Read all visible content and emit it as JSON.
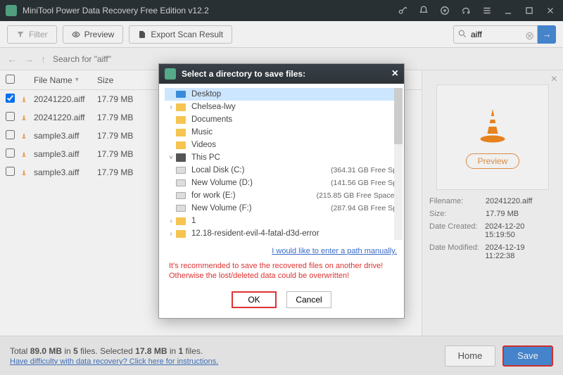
{
  "title": "MiniTool Power Data Recovery Free Edition v12.2",
  "toolbar": {
    "filter": "Filter",
    "preview": "Preview",
    "export": "Export Scan Result"
  },
  "search": {
    "value": "aiff",
    "breadcrumb": "Search for  \"aiff\""
  },
  "table": {
    "headers": {
      "name": "File Name",
      "size": "Size"
    },
    "rows": [
      {
        "checked": true,
        "name": "20241220.aiff",
        "size": "17.79 MB"
      },
      {
        "checked": false,
        "name": "20241220.aiff",
        "size": "17.79 MB"
      },
      {
        "checked": false,
        "name": "sample3.aiff",
        "size": "17.79 MB"
      },
      {
        "checked": false,
        "name": "sample3.aiff",
        "size": "17.79 MB"
      },
      {
        "checked": false,
        "name": "sample3.aiff",
        "size": "17.79 MB"
      }
    ]
  },
  "preview": {
    "button": "Preview",
    "meta": {
      "filename_k": "Filename:",
      "filename_v": "20241220.aiff",
      "size_k": "Size:",
      "size_v": "17.79 MB",
      "created_k": "Date Created:",
      "created_v": "2024-12-20 15:19:50",
      "modified_k": "Date Modified:",
      "modified_v": "2024-12-19 11:22:38"
    }
  },
  "footer": {
    "total_prefix": "Total ",
    "total_size": "89.0 MB",
    "total_mid": " in ",
    "total_files": "5",
    "total_suffix": " files.  ",
    "sel_prefix": "Selected ",
    "sel_size": "17.8 MB",
    "sel_mid": " in ",
    "sel_files": "1",
    "sel_suffix": " files.",
    "help": "Have difficulty with data recovery? Click here for instructions.",
    "home": "Home",
    "save": "Save"
  },
  "modal": {
    "title": "Select a directory to save files:",
    "tree": [
      {
        "level": 0,
        "exp": "",
        "icon": "desk",
        "label": "Desktop",
        "sel": true,
        "free": ""
      },
      {
        "level": 1,
        "exp": "›",
        "icon": "folder",
        "label": "Chelsea-lwy",
        "free": ""
      },
      {
        "level": 1,
        "exp": "",
        "icon": "folder",
        "label": "Documents",
        "free": ""
      },
      {
        "level": 1,
        "exp": "",
        "icon": "folder",
        "label": "Music",
        "free": ""
      },
      {
        "level": 1,
        "exp": "",
        "icon": "folder",
        "label": "Videos",
        "free": ""
      },
      {
        "level": 1,
        "exp": "˅",
        "icon": "pc",
        "label": "This PC",
        "free": ""
      },
      {
        "level": 2,
        "exp": "",
        "icon": "drive",
        "label": "Local Disk (C:)",
        "free": "(364.31 GB Free Sp"
      },
      {
        "level": 2,
        "exp": "",
        "icon": "drive",
        "label": "New Volume (D:)",
        "free": "(141.56 GB Free Sp"
      },
      {
        "level": 2,
        "exp": "",
        "icon": "drive",
        "label": "for work (E:)",
        "free": "(215.85 GB Free Space)"
      },
      {
        "level": 2,
        "exp": "",
        "icon": "drive",
        "label": "New Volume (F:)",
        "free": "(287.94 GB Free Sp"
      },
      {
        "level": 1,
        "exp": "›",
        "icon": "folder",
        "label": "1",
        "free": ""
      },
      {
        "level": 1,
        "exp": "›",
        "icon": "folder",
        "label": "12.18-resident-evil-4-fatal-d3d-error",
        "free": ""
      }
    ],
    "manual": "I would like to enter a path manually.",
    "warning": "It's recommended to save the recovered files on another drive! Otherwise the lost/deleted data could be overwritten!",
    "ok": "OK",
    "cancel": "Cancel"
  }
}
